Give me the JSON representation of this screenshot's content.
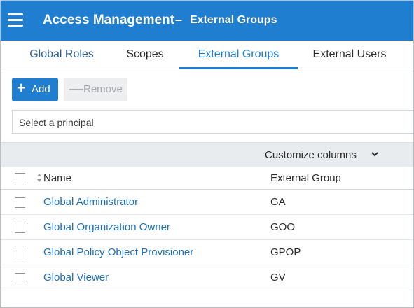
{
  "header": {
    "menu_icon": "hamburger-menu-icon",
    "app_title": "Access Management",
    "separator": "–",
    "page_title": "External Groups",
    "background": "#1f7ed0"
  },
  "tabs": [
    {
      "label": "Global Roles",
      "active": false
    },
    {
      "label": "Scopes",
      "active": false
    },
    {
      "label": "External Groups",
      "active": true
    },
    {
      "label": "External Users",
      "active": false
    }
  ],
  "toolbar": {
    "add_label": "Add",
    "add_icon": "plus-icon",
    "remove_label": "Remove",
    "remove_icon": "minus-icon",
    "remove_disabled": true
  },
  "principal": {
    "placeholder": "Select a principal"
  },
  "customize": {
    "label": "Customize columns",
    "icon": "chevron-down-icon"
  },
  "table": {
    "columns": [
      "Name",
      "External Group"
    ],
    "sort_icon": "sort-icon",
    "rows": [
      {
        "name": "Global Administrator",
        "external_group": "GA"
      },
      {
        "name": "Global Organization Owner",
        "external_group": "GOO"
      },
      {
        "name": "Global Policy Object Provisioner",
        "external_group": "GPOP"
      },
      {
        "name": "Global Viewer",
        "external_group": "GV"
      }
    ]
  },
  "colors": {
    "accent": "#1f7ed0",
    "link": "#1f6fb8",
    "disabled_bg": "#eceef0",
    "bar_bg": "#e8ecef"
  }
}
